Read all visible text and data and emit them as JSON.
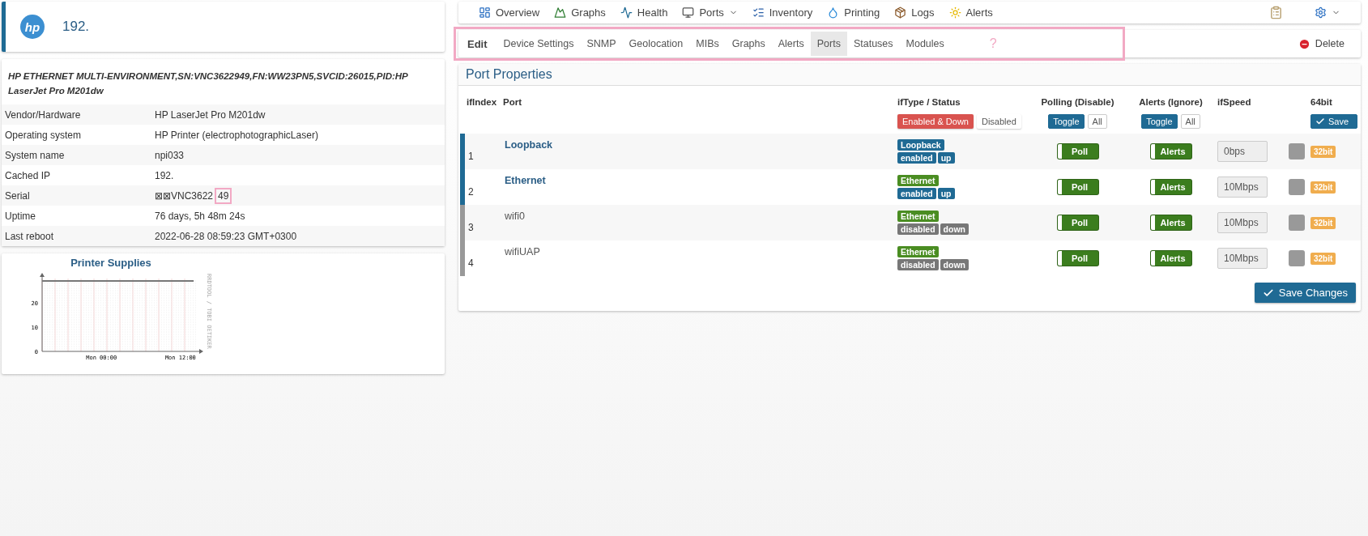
{
  "device": {
    "logo": "hp",
    "title": "192."
  },
  "info": {
    "description": "HP ETHERNET MULTI-ENVIRONMENT,SN:VNC3622949,FN:WW23PN5,SVCID:26015,PID:HP LaserJet Pro M201dw",
    "rows": [
      {
        "label": "Vendor/Hardware",
        "value": "HP LaserJet Pro M201dw"
      },
      {
        "label": "Operating system",
        "value": "HP Printer (electrophotographicLaser)"
      },
      {
        "label": "System name",
        "value": "npi033"
      },
      {
        "label": "Cached IP",
        "value": "192."
      },
      {
        "label": "Serial",
        "value": "⊠⊠VNC3622",
        "marked": "49"
      },
      {
        "label": "Uptime",
        "value": "76 days, 5h 48m 24s"
      },
      {
        "label": "Last reboot",
        "value": "2022-06-28 08:59:23 GMT+0300"
      }
    ]
  },
  "supplies": {
    "title": "Printer Supplies",
    "watermark": "RRDTOOL / TOBI OETIKER",
    "chart_data": {
      "type": "line",
      "categories": [
        null,
        null,
        null,
        null,
        null,
        null,
        null,
        null,
        null,
        "Mon 00:00",
        null,
        null,
        null,
        null,
        null,
        null,
        null,
        null,
        null,
        null,
        null,
        "Mon 12:00",
        null,
        null
      ],
      "ylim": [
        0,
        30
      ],
      "yticks": [
        0,
        10,
        20
      ],
      "grid": true,
      "series": [
        {
          "color": "#777777",
          "values": [
            29,
            29,
            29,
            29,
            29,
            29,
            29,
            29,
            29,
            29,
            29,
            29,
            29,
            29,
            29,
            29,
            29,
            29,
            29,
            29,
            29,
            29,
            29,
            29
          ]
        }
      ]
    }
  },
  "top_nav": {
    "items": [
      {
        "label": "Overview",
        "dropdown": false
      },
      {
        "label": "Graphs",
        "dropdown": false
      },
      {
        "label": "Health",
        "dropdown": false
      },
      {
        "label": "Ports",
        "dropdown": true
      },
      {
        "label": "Inventory",
        "dropdown": false
      },
      {
        "label": "Printing",
        "dropdown": false
      },
      {
        "label": "Logs",
        "dropdown": false
      },
      {
        "label": "Alerts",
        "dropdown": false
      }
    ]
  },
  "edit_nav": {
    "title": "Edit",
    "highlighted": true,
    "note": "?",
    "tabs": [
      {
        "label": "Device Settings",
        "selected": false
      },
      {
        "label": "SNMP",
        "selected": false
      },
      {
        "label": "Geolocation",
        "selected": false
      },
      {
        "label": "MIBs",
        "selected": false
      },
      {
        "label": "Graphs",
        "selected": false
      },
      {
        "label": "Alerts",
        "selected": false
      },
      {
        "label": "Ports",
        "selected": true
      },
      {
        "label": "Statuses",
        "selected": false
      },
      {
        "label": "Modules",
        "selected": false
      }
    ],
    "delete": "Delete"
  },
  "ports": {
    "title": "Port Properties",
    "columns": [
      "ifIndex",
      "Port",
      "ifType / Status",
      "Polling (Disable)",
      "Alerts (Ignore)",
      "ifSpeed",
      "",
      "64bit"
    ],
    "filters": [
      {
        "label": "Enabled & Down",
        "selected": true
      },
      {
        "label": "Disabled",
        "selected": false
      }
    ],
    "polling_buttons": [
      "Toggle",
      "All"
    ],
    "alerts_buttons": [
      "Toggle",
      "All"
    ],
    "save": "Save",
    "rows": [
      {
        "index": "1",
        "port": "Loopback",
        "type": "Loopback",
        "color": "#1f6a94",
        "admin": "enabled",
        "admin_up": true,
        "oper": "up",
        "oper_up": true,
        "poll": true,
        "poll_label": "Poll",
        "alerts": true,
        "alerts_label": "Alerts",
        "speed": "0bps",
        "checked": false,
        "bits": "32bit"
      },
      {
        "index": "2",
        "port": "Ethernet",
        "type": "Ethernet",
        "color": "#4a8d22",
        "admin": "enabled",
        "admin_up": true,
        "oper": "up",
        "oper_up": true,
        "poll": true,
        "poll_label": "Poll",
        "alerts": true,
        "alerts_label": "Alerts",
        "speed": "10Mbps",
        "checked": false,
        "bits": "32bit"
      },
      {
        "index": "3",
        "port": "wifi0",
        "type": "Ethernet",
        "color": "#4a8d22",
        "admin": "disabled",
        "admin_up": false,
        "oper": "down",
        "oper_up": false,
        "poll": true,
        "poll_label": "Poll",
        "alerts": true,
        "alerts_label": "Alerts",
        "speed": "10Mbps",
        "checked": false,
        "bits": "32bit"
      },
      {
        "index": "4",
        "port": "wifiUAP",
        "type": "Ethernet",
        "color": "#4a8d22",
        "admin": "disabled",
        "admin_up": false,
        "oper": "down",
        "oper_up": false,
        "poll": true,
        "poll_label": "Poll",
        "alerts": true,
        "alerts_label": "Alerts",
        "speed": "10Mbps",
        "checked": false,
        "bits": "32bit"
      }
    ],
    "save_changes": "Save Changes"
  }
}
